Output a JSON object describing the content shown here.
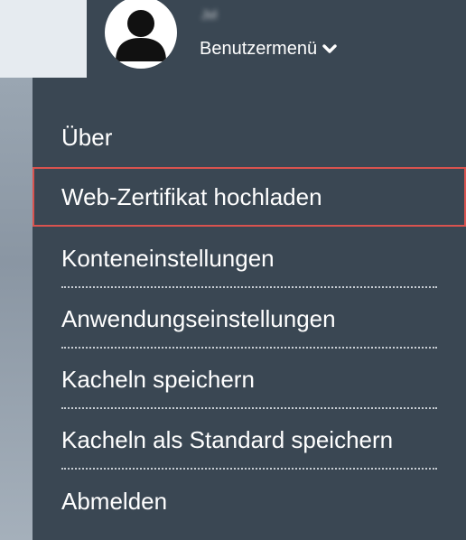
{
  "user_header": {
    "username": "Jvl",
    "menu_label": "Benutzermenü"
  },
  "menu": {
    "items": [
      {
        "label": "Über"
      },
      {
        "label": "Web-Zertifikat hochladen",
        "highlighted": true
      },
      {
        "label": "Konteneinstellungen"
      },
      {
        "label": "Anwendungseinstellungen"
      },
      {
        "label": "Kacheln speichern"
      },
      {
        "label": "Kacheln als Standard speichern"
      },
      {
        "label": "Abmelden"
      }
    ]
  },
  "colors": {
    "menu_background": "#3a4753",
    "highlight_border": "#d9534f",
    "text": "#ffffff"
  }
}
